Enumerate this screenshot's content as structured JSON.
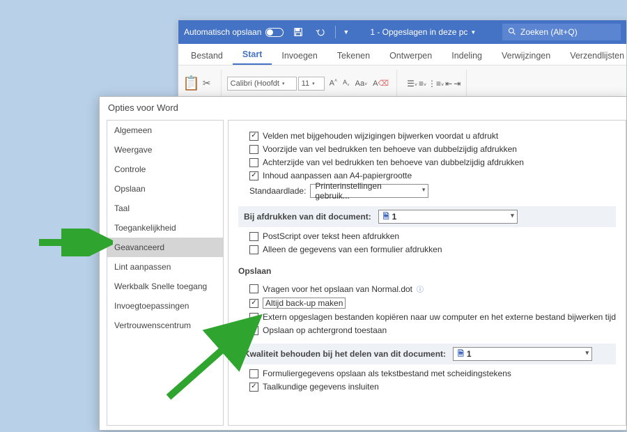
{
  "titlebar": {
    "autosave_label": "Automatisch opslaan",
    "doc_title": "1 - Opgeslagen in deze pc",
    "search_placeholder": "Zoeken (Alt+Q)"
  },
  "ribbon": {
    "tabs": {
      "bestand": "Bestand",
      "start": "Start",
      "invoegen": "Invoegen",
      "tekenen": "Tekenen",
      "ontwerpen": "Ontwerpen",
      "indeling": "Indeling",
      "verwijzingen": "Verwijzingen",
      "verzendlijsten": "Verzendlijsten"
    },
    "font_name": "Calibri (Hoofdt",
    "font_size": "11"
  },
  "dialog": {
    "title": "Opties voor Word",
    "sidebar": {
      "algemeen": "Algemeen",
      "weergave": "Weergave",
      "controle": "Controle",
      "opslaan": "Opslaan",
      "taal": "Taal",
      "toegankelijkheid": "Toegankelijkheid",
      "geavanceerd": "Geavanceerd",
      "lint": "Lint aanpassen",
      "werkbalk": "Werkbalk Snelle toegang",
      "invoeg": "Invoegtoepassingen",
      "vertrouwen": "Vertrouwenscentrum"
    },
    "print": {
      "opt1": "Velden met bijgehouden wijzigingen bijwerken voordat u afdrukt",
      "opt2": "Voorzijde van vel bedrukken ten behoeve van dubbelzijdig afdrukken",
      "opt3": "Achterzijde van vel bedrukken ten behoeve van dubbelzijdig afdrukken",
      "opt4": "Inhoud aanpassen aan A4-papiergrootte",
      "std_label": "Standaardlade:",
      "std_value": "Printerinstellingen gebruik..."
    },
    "sec_print_doc": {
      "label": "Bij afdrukken van dit document:",
      "dd_value": "1",
      "opt1": "PostScript over tekst heen afdrukken",
      "opt2": "Alleen de gegevens van een formulier afdrukken"
    },
    "sec_save": {
      "label": "Opslaan",
      "opt1": "Vragen voor het opslaan van Normal.dot",
      "opt2": "Altijd back-up maken",
      "opt3": "Extern opgeslagen bestanden kopiëren naar uw computer en het externe bestand bijwerken tijdens het o",
      "opt4": "Opslaan op achtergrond toestaan"
    },
    "sec_quality": {
      "label": "Kwaliteit behouden bij het delen van dit document:",
      "dd_value": "1",
      "opt1": "Formuliergegevens opslaan als tekstbestand met scheidingstekens",
      "opt2": "Taalkundige gegevens insluiten"
    }
  }
}
